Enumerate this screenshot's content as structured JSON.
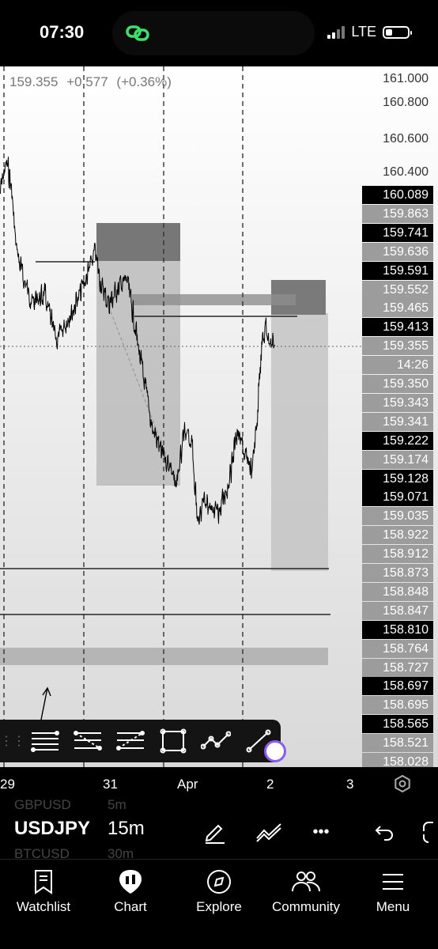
{
  "status_bar": {
    "time": "07:30",
    "network": "LTE"
  },
  "chart": {
    "header": {
      "last_price": "159.355",
      "change": "+0.577",
      "change_pct": "(+0.36%)"
    },
    "price_scale": [
      {
        "label": "161.000",
        "style": "plain"
      },
      {
        "label": "160.800",
        "style": "plain"
      },
      {
        "label": "160.600",
        "style": "plain"
      },
      {
        "label": "160.400",
        "style": "plain"
      },
      {
        "label": "160.089",
        "style": "dark"
      },
      {
        "label": "159.863",
        "style": "gray"
      },
      {
        "label": "159.741",
        "style": "dark"
      },
      {
        "label": "159.636",
        "style": "gray"
      },
      {
        "label": "159.591",
        "style": "dark"
      },
      {
        "label": "159.552",
        "style": "gray"
      },
      {
        "label": "159.465",
        "style": "gray"
      },
      {
        "label": "159.413",
        "style": "dark"
      },
      {
        "label": "159.355",
        "style": "gray"
      },
      {
        "label": "14:26",
        "style": "gray"
      },
      {
        "label": "159.350",
        "style": "gray"
      },
      {
        "label": "159.343",
        "style": "gray"
      },
      {
        "label": "159.341",
        "style": "gray"
      },
      {
        "label": "159.222",
        "style": "dark"
      },
      {
        "label": "159.174",
        "style": "gray"
      },
      {
        "label": "159.128",
        "style": "dark"
      },
      {
        "label": "159.071",
        "style": "dark"
      },
      {
        "label": "159.035",
        "style": "gray"
      },
      {
        "label": "158.922",
        "style": "gray"
      },
      {
        "label": "158.912",
        "style": "gray"
      },
      {
        "label": "158.873",
        "style": "gray"
      },
      {
        "label": "158.848",
        "style": "gray"
      },
      {
        "label": "158.847",
        "style": "gray"
      },
      {
        "label": "158.810",
        "style": "dark"
      },
      {
        "label": "158.764",
        "style": "gray"
      },
      {
        "label": "158.727",
        "style": "gray"
      },
      {
        "label": "158.697",
        "style": "dark"
      },
      {
        "label": "158.695",
        "style": "gray"
      },
      {
        "label": "158.565",
        "style": "dark"
      },
      {
        "label": "158.521",
        "style": "gray"
      },
      {
        "label": "158.028",
        "style": "gray"
      }
    ],
    "time_axis": [
      "29",
      "31",
      "Apr",
      "2",
      "3"
    ]
  },
  "drawing_toolbar": {
    "tools": [
      "horizontal-lines-icon",
      "fib-retracement-icon",
      "parallel-channel-icon",
      "rectangle-icon",
      "path-icon",
      "trend-line-icon"
    ]
  },
  "symbol_bar": {
    "symbol_above": "GBPUSD",
    "symbol": "USDJPY",
    "symbol_below": "BTCUSD",
    "interval_above": "5m",
    "interval": "15m",
    "interval_below": "30m",
    "more": "•••"
  },
  "bottom_nav": {
    "items": [
      {
        "label": "Watchlist",
        "icon": "bookmark-icon"
      },
      {
        "label": "Chart",
        "icon": "chart-icon"
      },
      {
        "label": "Explore",
        "icon": "compass-icon"
      },
      {
        "label": "Community",
        "icon": "people-icon"
      },
      {
        "label": "Menu",
        "icon": "menu-icon"
      }
    ]
  }
}
